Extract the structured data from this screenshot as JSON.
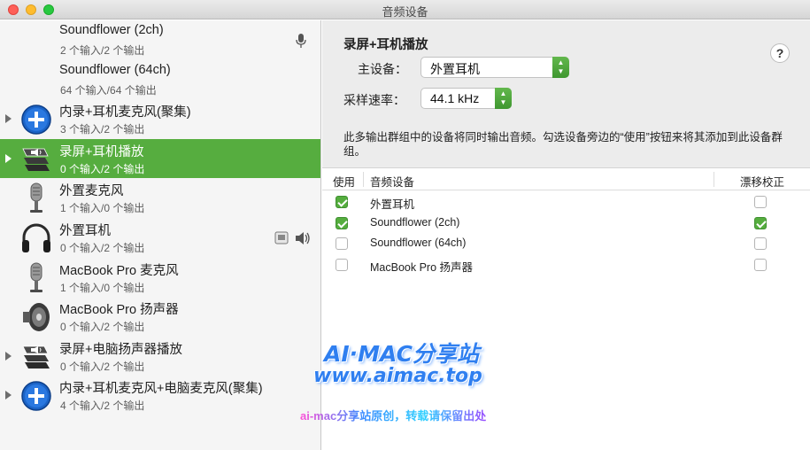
{
  "window": {
    "title": "音频设备"
  },
  "sidebar": {
    "devices": [
      {
        "name": "Soundflower (2ch)",
        "io": "2 个输入/2 个输出",
        "icon": "none",
        "expandable": false,
        "status": "mic-icon"
      },
      {
        "name": "Soundflower (64ch)",
        "io": "64 个输入/64 个输出",
        "icon": "none",
        "expandable": false,
        "status": ""
      },
      {
        "name": "内录+耳机麦克风(聚集)",
        "io": "3 个输入/2 个输出",
        "icon": "aggregate-plus-icon",
        "expandable": true,
        "status": ""
      },
      {
        "name": "录屏+耳机播放",
        "io": "0 个输入/2 个输出",
        "icon": "multi-output-icon",
        "expandable": true,
        "status": "",
        "selected": true
      },
      {
        "name": "外置麦克风",
        "io": "1 个输入/0 个输出",
        "icon": "microphone-icon",
        "expandable": false,
        "status": ""
      },
      {
        "name": "外置耳机",
        "io": "0 个输入/2 个输出",
        "icon": "headphones-icon",
        "expandable": false,
        "status": "output-speaker-icon"
      },
      {
        "name": "MacBook Pro 麦克风",
        "io": "1 个输入/0 个输出",
        "icon": "microphone-icon",
        "expandable": false,
        "status": ""
      },
      {
        "name": "MacBook Pro 扬声器",
        "io": "0 个输入/2 个输出",
        "icon": "speaker-icon",
        "expandable": false,
        "status": ""
      },
      {
        "name": "录屏+电脑扬声器播放",
        "io": "0 个输入/2 个输出",
        "icon": "multi-output-icon",
        "expandable": true,
        "status": ""
      },
      {
        "name": "内录+耳机麦克风+电脑麦克风(聚集)",
        "io": "4 个输入/2 个输出",
        "icon": "aggregate-plus-icon",
        "expandable": true,
        "status": ""
      }
    ]
  },
  "detail": {
    "title": "录屏+耳机播放",
    "help_label": "?",
    "master_label": "主设备：",
    "master_value": "外置耳机",
    "rate_label": "采样速率：",
    "rate_value": "44.1 kHz",
    "description": "此多输出群组中的设备将同时输出音频。勾选设备旁边的“使用”按钮来将其添加到此设备群组。",
    "table": {
      "headers": {
        "use": "使用",
        "device": "音频设备",
        "drift": "漂移校正"
      },
      "rows": [
        {
          "device": "外置耳机",
          "use": true,
          "drift": false
        },
        {
          "device": "Soundflower (2ch)",
          "use": true,
          "drift": true
        },
        {
          "device": "Soundflower (64ch)",
          "use": false,
          "drift": false
        },
        {
          "device": "MacBook Pro 扬声器",
          "use": false,
          "drift": false
        }
      ]
    }
  },
  "watermark": {
    "line1": "AI·MAC分享站",
    "line2": "www.aimac.top",
    "line3": "ai-mac分享站原创，转载请保留出处"
  },
  "colors": {
    "selection": "#56ad3f",
    "accent": "#55ad3e"
  }
}
